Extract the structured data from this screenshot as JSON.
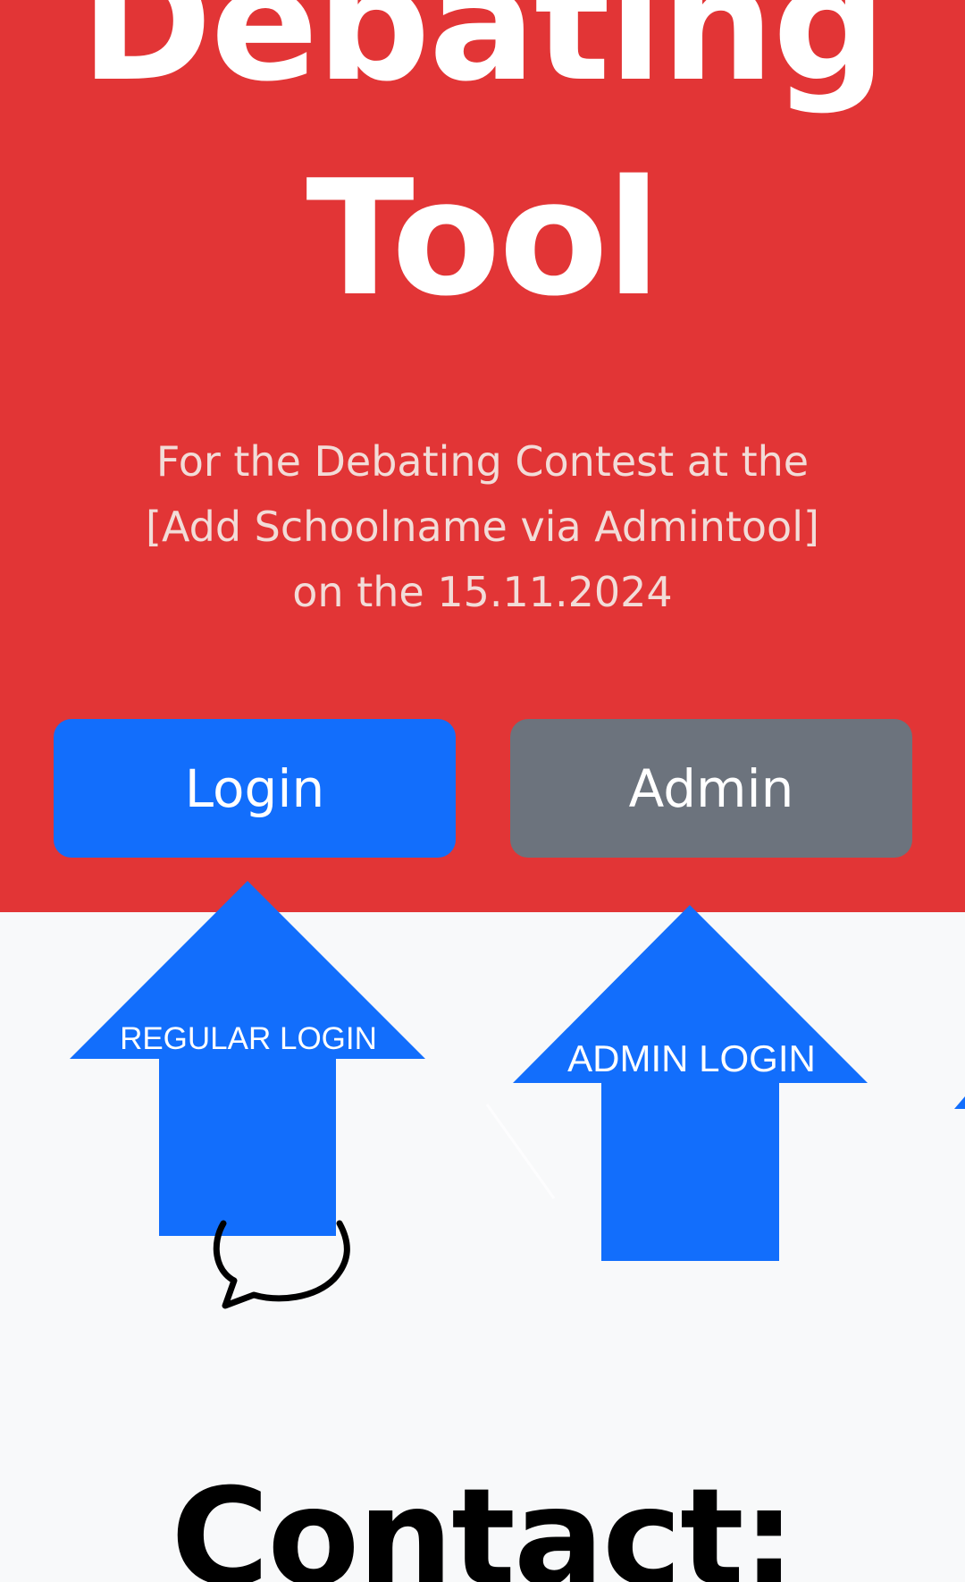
{
  "hero": {
    "title_line1": "Debating",
    "title_line2": "Tool",
    "subtitle_line1": "For the Debating Contest at the",
    "subtitle_line2": "[Add Schoolname via Admintool]",
    "subtitle_line3": "on the 15.11.2024"
  },
  "buttons": {
    "login_label": "Login",
    "admin_label": "Admin"
  },
  "annotations": {
    "regular_login": "REGULAR LOGIN",
    "admin_login": "ADMIN LOGIN"
  },
  "contact": {
    "heading": "Contact:"
  },
  "colors": {
    "hero_bg": "#e23536",
    "login_button": "#126efc",
    "admin_button": "#6c737d",
    "arrow": "#126efc",
    "page_bg": "#f8f9fa"
  },
  "icons": {
    "chat": "speech-bubble-icon"
  }
}
